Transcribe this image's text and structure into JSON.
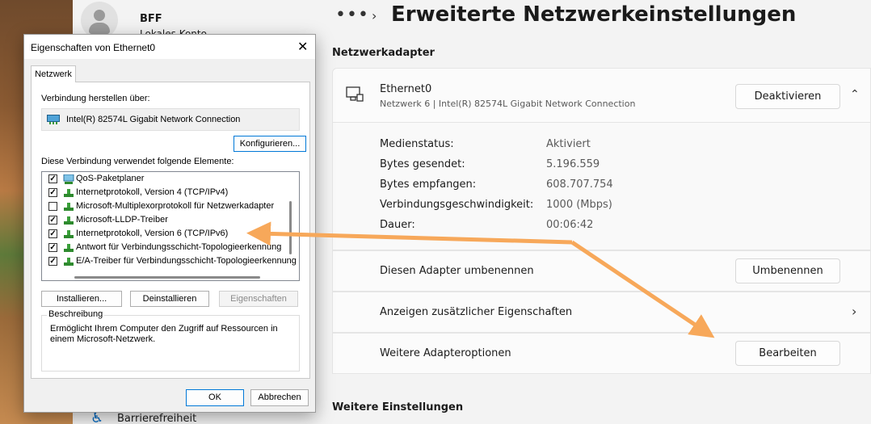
{
  "user": {
    "name": "BFF",
    "account_type": "Lokales Konto"
  },
  "nav": {
    "accessibility_label": "Barrierefreiheit"
  },
  "header": {
    "dots": "•••",
    "title": "Erweiterte Netzwerkeinstellungen"
  },
  "sections": {
    "adapters_title": "Netzwerkadapter",
    "more_settings_title": "Weitere Einstellungen"
  },
  "adapter": {
    "name": "Ethernet0",
    "subtitle": "Netzwerk 6 | Intel(R) 82574L Gigabit Network Connection",
    "deactivate_label": "Deaktivieren",
    "details": [
      {
        "label": "Medienstatus:",
        "value": "Aktiviert"
      },
      {
        "label": "Bytes gesendet:",
        "value": "5.196.559"
      },
      {
        "label": "Bytes empfangen:",
        "value": "608.707.754"
      },
      {
        "label": "Verbindungsgeschwindigkeit:",
        "value": "1000 (Mbps)"
      },
      {
        "label": "Dauer:",
        "value": "00:06:42"
      }
    ],
    "rename_row": {
      "label": "Diesen Adapter umbenennen",
      "button": "Umbenennen"
    },
    "props_row": {
      "label": "Anzeigen zusätzlicher Eigenschaften"
    },
    "options_row": {
      "label": "Weitere Adapteroptionen",
      "button": "Bearbeiten"
    }
  },
  "dialog": {
    "title": "Eigenschaften von Ethernet0",
    "close": "✕",
    "tab": "Netzwerk",
    "connect_using_label": "Verbindung herstellen über:",
    "adapter_name": "Intel(R) 82574L Gigabit Network Connection",
    "configure_button": "Konfigurieren...",
    "items_label": "Diese Verbindung verwendet folgende Elemente:",
    "items": [
      {
        "label": "QoS-Paketplaner",
        "checked": "✓"
      },
      {
        "label": "Internetprotokoll, Version 4 (TCP/IPv4)",
        "checked": "✓"
      },
      {
        "label": "Microsoft-Multiplexorprotokoll für Netzwerkadapter",
        "checked": ""
      },
      {
        "label": "Microsoft-LLDP-Treiber",
        "checked": "✓"
      },
      {
        "label": "Internetprotokoll, Version 6 (TCP/IPv6)",
        "checked": "✓"
      },
      {
        "label": "Antwort für Verbindungsschicht-Topologieerkennung",
        "checked": "✓"
      },
      {
        "label": "E/A-Treiber für Verbindungsschicht-Topologieerkennung",
        "checked": "✓"
      }
    ],
    "install_button": "Installieren...",
    "uninstall_button": "Deinstallieren",
    "properties_button": "Eigenschaften",
    "description_legend": "Beschreibung",
    "description_text": "Ermöglicht Ihrem Computer den Zugriff auf Ressourcen in einem Microsoft-Netzwerk.",
    "ok_button": "OK",
    "cancel_button": "Abbrechen"
  },
  "colors": {
    "arrow": "#f7a85a",
    "accent": "#0067c0"
  }
}
